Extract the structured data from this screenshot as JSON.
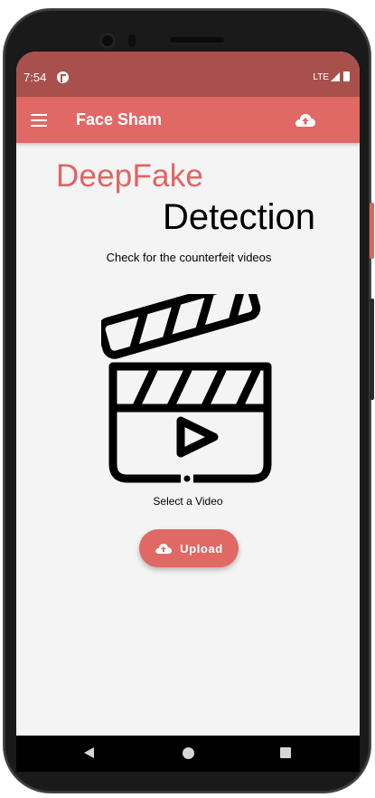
{
  "status_bar": {
    "time": "7:54",
    "network": "LTE"
  },
  "app_bar": {
    "title": "Face Sham",
    "menu_icon": "hamburger-menu-icon",
    "action_icon": "cloud-upload-icon"
  },
  "main": {
    "title_line1": "DeepFake",
    "title_line2": "Detection",
    "subtitle": "Check for the counterfeit videos",
    "illustration": "clapperboard-play-icon",
    "select_label": "Select a Video",
    "upload_button_label": "Upload"
  },
  "nav_bar": {
    "icons": [
      "back-icon",
      "home-icon",
      "recents-icon"
    ]
  },
  "colors": {
    "status_bar": "#a9504d",
    "app_bar": "#e06865",
    "accent": "#df6562",
    "background": "#f4f4f4"
  }
}
